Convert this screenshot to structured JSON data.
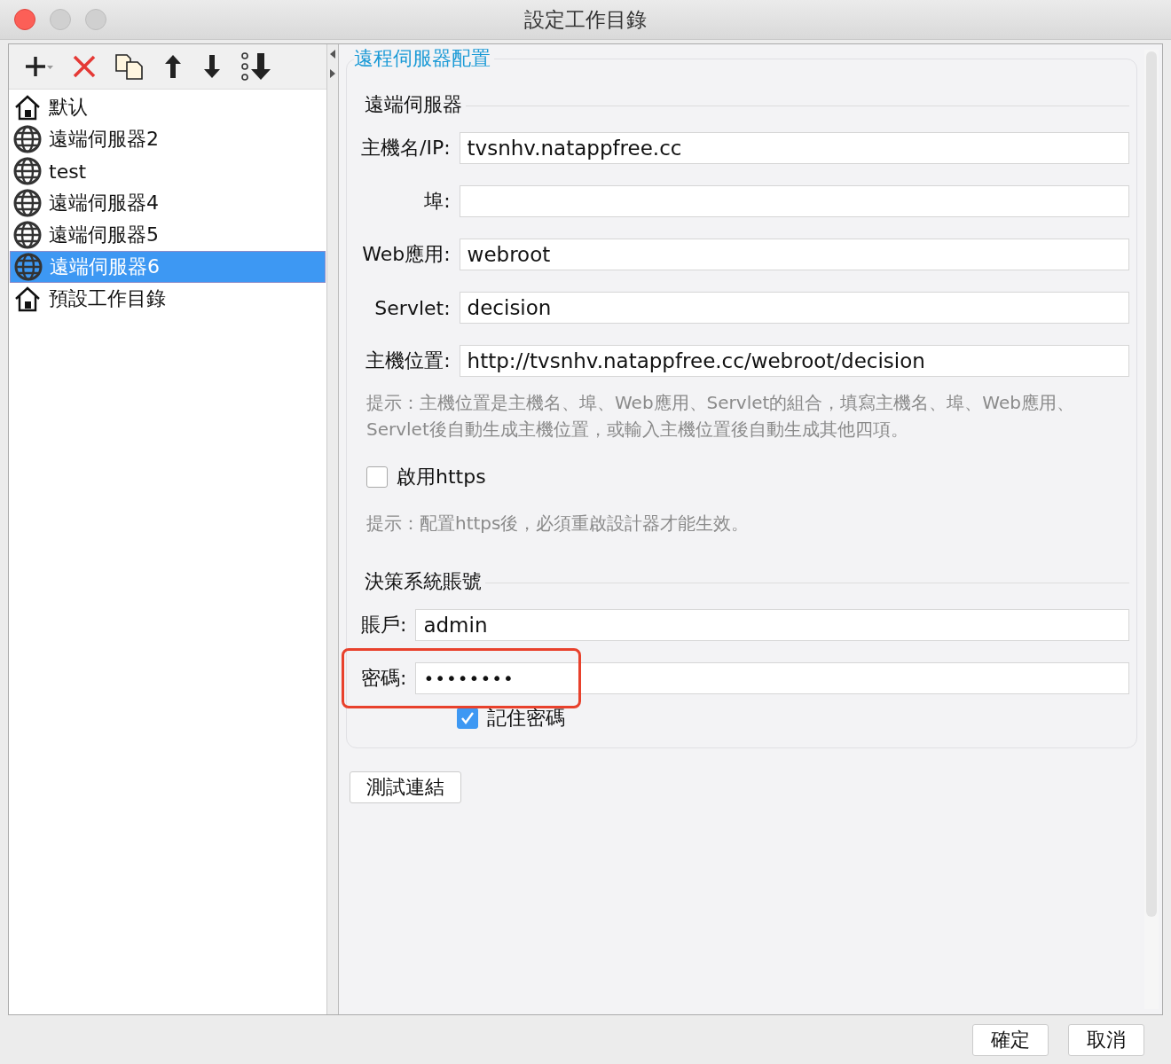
{
  "window": {
    "title": "設定工作目錄"
  },
  "tree": {
    "items": [
      {
        "label": "默认",
        "kind": "home",
        "selected": false
      },
      {
        "label": "遠端伺服器2",
        "kind": "globe",
        "selected": false
      },
      {
        "label": "test",
        "kind": "globe",
        "selected": false
      },
      {
        "label": "遠端伺服器4",
        "kind": "globe",
        "selected": false
      },
      {
        "label": "遠端伺服器5",
        "kind": "globe",
        "selected": false
      },
      {
        "label": "遠端伺服器6",
        "kind": "globe",
        "selected": true
      },
      {
        "label": "預設工作目錄",
        "kind": "home",
        "selected": false
      }
    ]
  },
  "panel": {
    "title": "遠程伺服器配置",
    "server": {
      "title": "遠端伺服器",
      "fields": [
        {
          "label": "主機名/IP:",
          "value": "tvsnhv.natappfree.cc"
        },
        {
          "label": "埠:"
        },
        {
          "label": "Web應用:",
          "value": "webroot"
        },
        {
          "label": "Servlet:",
          "value": "decision"
        },
        {
          "label": "主機位置:",
          "value": "http://tvsnhv.natappfree.cc/webroot/decision"
        }
      ],
      "hint": "提示：主機位置是主機名、埠、Web應用、Servlet的組合，填寫主機名、埠、Web應用、Servlet後自動生成主機位置，或輸入主機位置後自動生成其他四項。",
      "https": {
        "label": "啟用https",
        "checked": false
      },
      "https_hint": "提示：配置https後，必須重啟設計器才能生效。"
    },
    "account": {
      "title": "決策系統賬號",
      "user": {
        "label": "賬戶:",
        "value": "admin"
      },
      "password": {
        "label": "密碼:",
        "value": "••••••••"
      },
      "remember": {
        "label": "記住密碼",
        "checked": true
      }
    }
  },
  "test_button": "測試連結",
  "buttons": [
    "確定",
    "取消"
  ]
}
